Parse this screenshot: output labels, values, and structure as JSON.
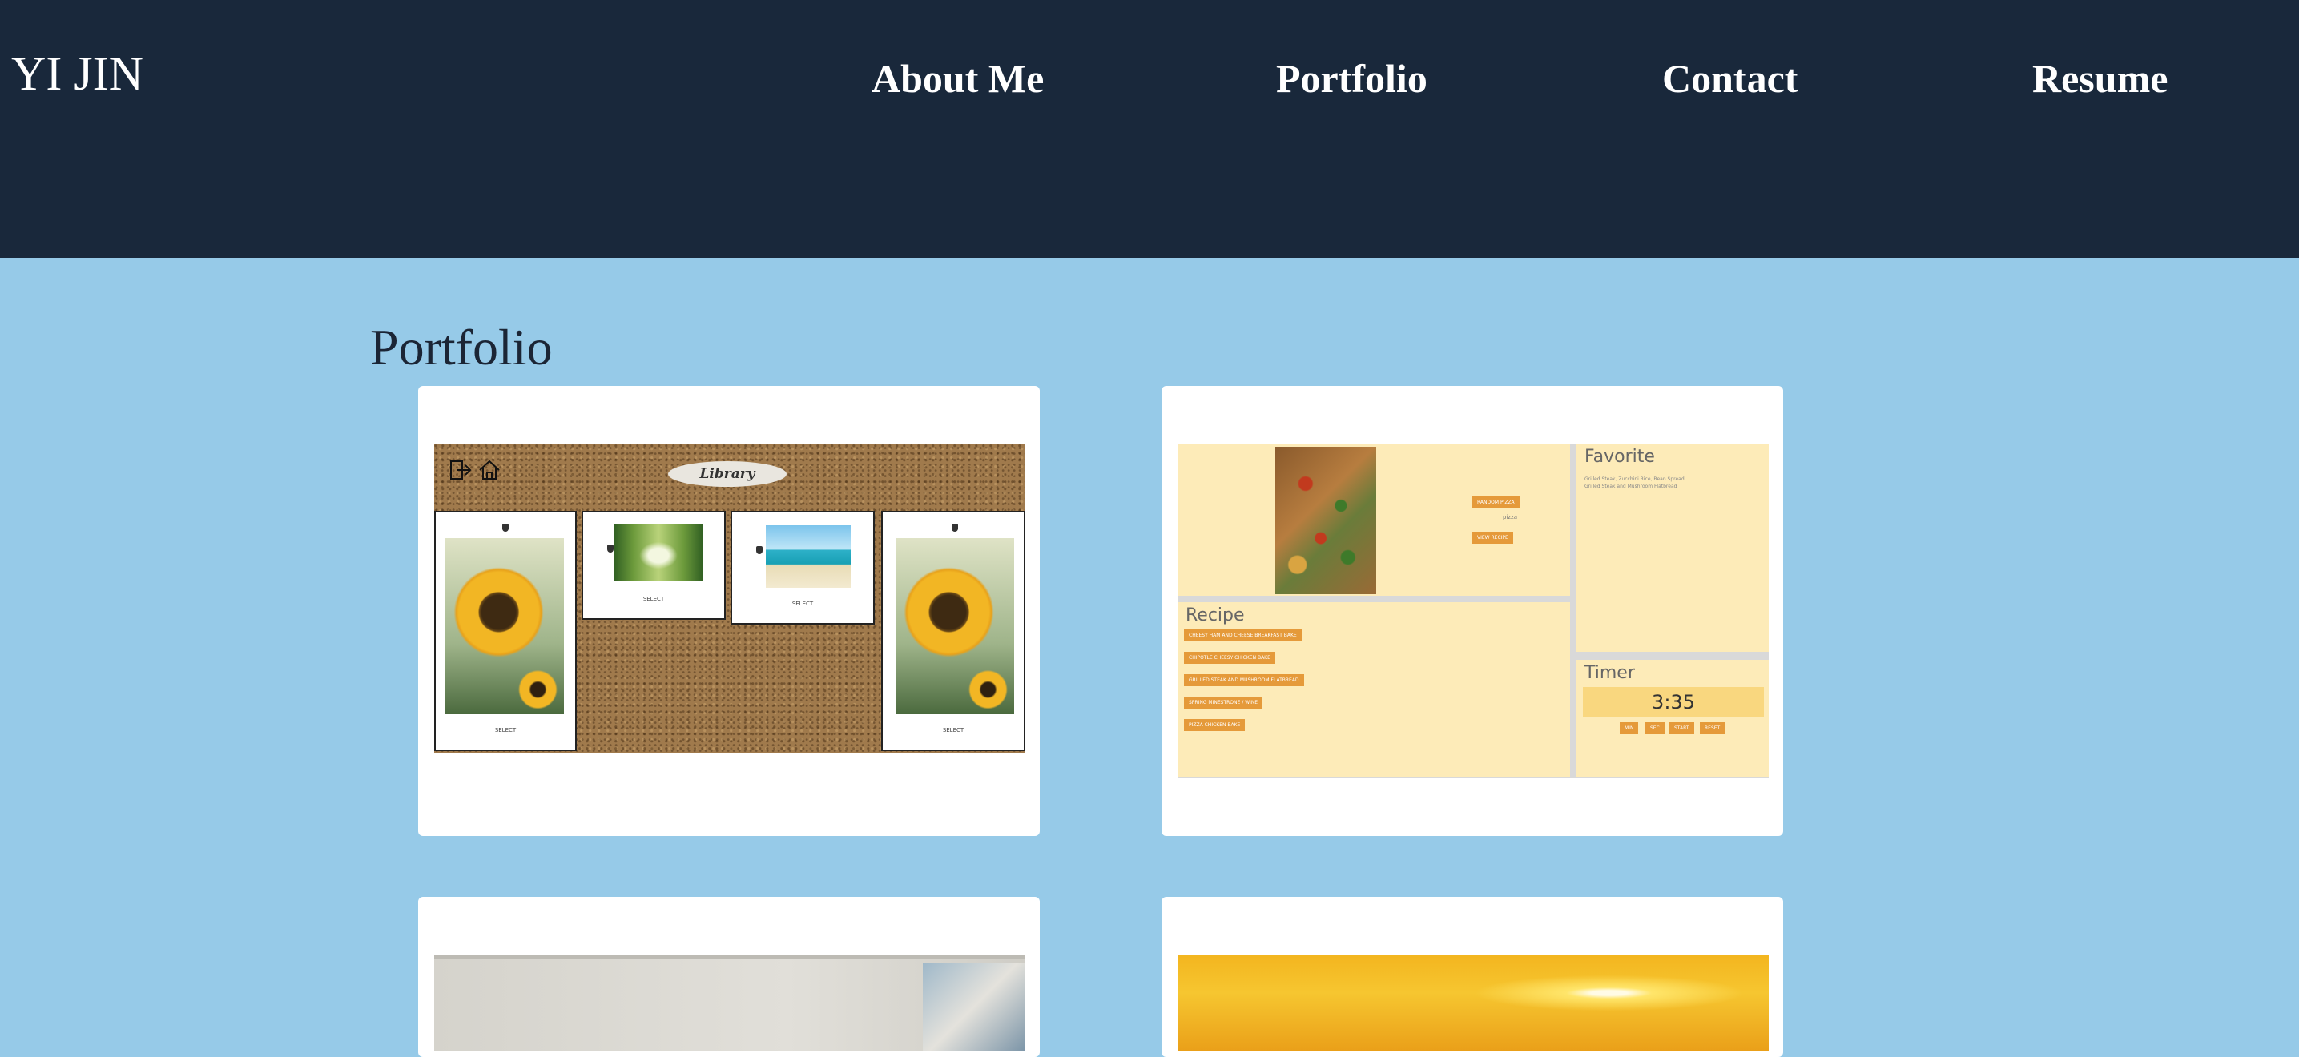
{
  "site": {
    "logo": "YI JIN"
  },
  "nav": {
    "items": [
      {
        "label": "About Me"
      },
      {
        "label": "Portfolio"
      },
      {
        "label": "Contact"
      },
      {
        "label": "Resume"
      }
    ]
  },
  "portfolio": {
    "title": "Portfolio",
    "projects": [
      {
        "thumbnail": "library-app-screenshot",
        "preview": {
          "banner": "Library",
          "polaroid_label": "SELECT",
          "icons": [
            "exit-icon",
            "home-icon"
          ]
        }
      },
      {
        "thumbnail": "recipe-app-screenshot",
        "preview": {
          "favorite_title": "Favorite",
          "favorite_text_1": "Grilled Steak, Zucchini Rice, Bean Spread",
          "favorite_text_2": "Grilled Steak and Mushroom Flatbread",
          "recipe_title": "Recipe",
          "recipe_items": [
            "CHEESY HAM AND CHEESE BREAKFAST BAKE",
            "CHIPOTLE CHEESY CHICKEN BAKE",
            "GRILLED STEAK AND MUSHROOM FLATBREAD",
            "SPRING MINESTRONE / WINE",
            "PIZZA CHICKEN BAKE"
          ],
          "pizza_buttons": [
            "RANDOM PIZZA",
            "VIEW RECIPE"
          ],
          "pizza_subtext": "pizza",
          "timer_title": "Timer",
          "timer_value": "3:35",
          "timer_buttons": [
            "MIN",
            "SEC",
            "START",
            "RESET"
          ]
        }
      },
      {
        "thumbnail": "room-photo"
      },
      {
        "thumbnail": "sunset-photo"
      }
    ]
  },
  "colors": {
    "header_bg": "#19283b",
    "page_bg": "#96cae8",
    "card_bg": "#ffffff",
    "accent_orange": "#e59a3a",
    "recipe_panel": "#fdebb8"
  }
}
